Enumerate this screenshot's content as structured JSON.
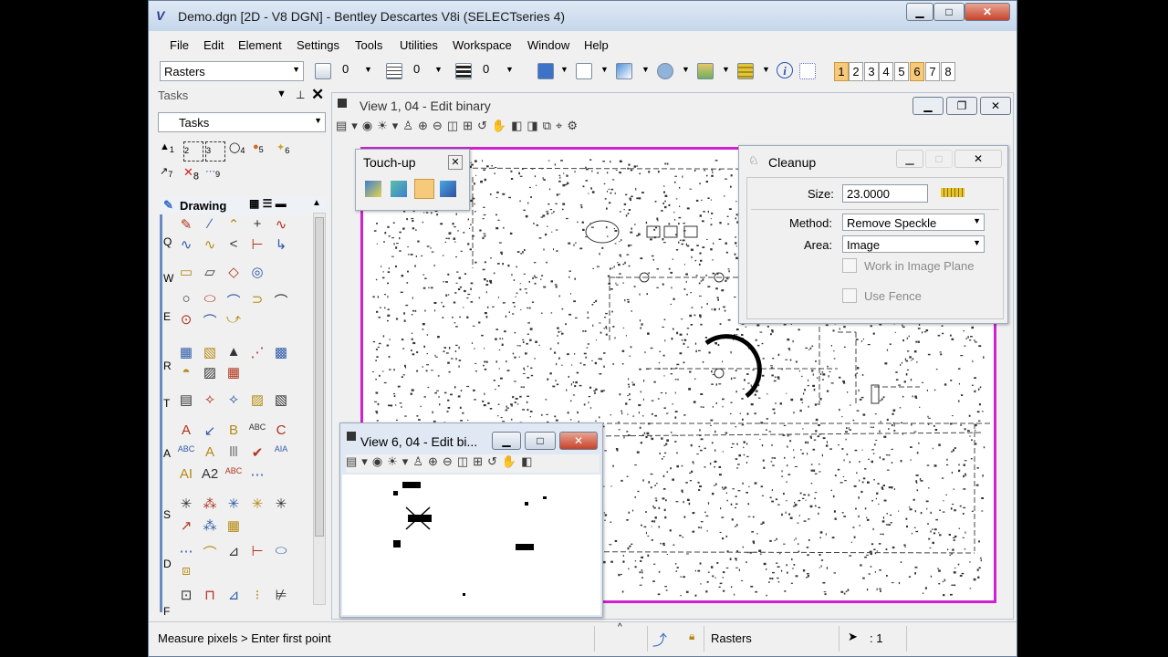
{
  "window": {
    "title": "Demo.dgn [2D - V8 DGN] - Bentley Descartes V8i (SELECTseries 4)",
    "app_icon": "bentley-icon"
  },
  "menu": [
    "File",
    "Edit",
    "Element",
    "Settings",
    "Tools",
    "Utilities",
    "Workspace",
    "Window",
    "Help"
  ],
  "toolbar": {
    "level_combo": "Rasters",
    "color_value": "0",
    "style_value": "0",
    "weight_value": "0",
    "view_buttons": [
      "1",
      "2",
      "3",
      "4",
      "5",
      "6",
      "7",
      "8"
    ],
    "active_views": [
      "1",
      "6"
    ]
  },
  "tasks": {
    "title": "Tasks",
    "combo": "Tasks",
    "top_tools": [
      "1",
      "2",
      "3",
      "4",
      "5",
      "6",
      "7",
      "8",
      "9"
    ],
    "drawing_label": "Drawing",
    "group_letters": [
      "Q",
      "W",
      "E",
      "R",
      "T",
      "A",
      "S",
      "D",
      "F"
    ]
  },
  "view1": {
    "title": "View 1, 04 - Edit binary"
  },
  "touchup": {
    "title": "Touch-up"
  },
  "cleanup": {
    "title": "Cleanup",
    "size_label": "Size:",
    "size_value": "23.0000",
    "method_label": "Method:",
    "method_value": "Remove Speckle",
    "area_label": "Area:",
    "area_value": "Image",
    "opt1": "Work in Image Plane",
    "opt2": "Use Fence"
  },
  "view6": {
    "title": "View 6, 04 - Edit bi..."
  },
  "status": {
    "prompt": "Measure pixels > Enter first point",
    "level": "Rasters",
    "count": ": 1"
  }
}
